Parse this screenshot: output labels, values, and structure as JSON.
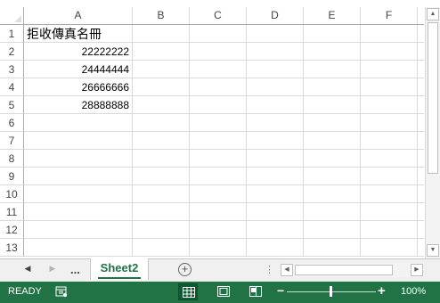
{
  "columns": [
    "A",
    "B",
    "C",
    "D",
    "E",
    "F"
  ],
  "rows": [
    "1",
    "2",
    "3",
    "4",
    "5",
    "6",
    "7",
    "8",
    "9",
    "10",
    "11",
    "12",
    "13"
  ],
  "cells": {
    "A1": "拒收傳真名冊",
    "A2": "22222222",
    "A3": "24444444",
    "A4": "26666666",
    "A5": "28888888"
  },
  "tabs": {
    "ellipsis": "...",
    "active_sheet": "Sheet2",
    "add_sheet_label": "+"
  },
  "statusbar": {
    "status": "READY",
    "zoom": "100%",
    "zoom_minus": "−",
    "zoom_plus": "+",
    "zoom_value": 100
  },
  "icons": {
    "tab_prev": "triangle-left-icon",
    "tab_next": "triangle-right-icon",
    "macro": "macro-record-icon",
    "normal_view": "normal-view-icon",
    "page_layout_view": "page-layout-view-icon",
    "page_break_view": "page-break-preview-icon"
  },
  "colors": {
    "accent": "#217346",
    "gridline": "#dadada",
    "header_border": "#ababab",
    "tabbar_bg": "#f0f0f0"
  }
}
